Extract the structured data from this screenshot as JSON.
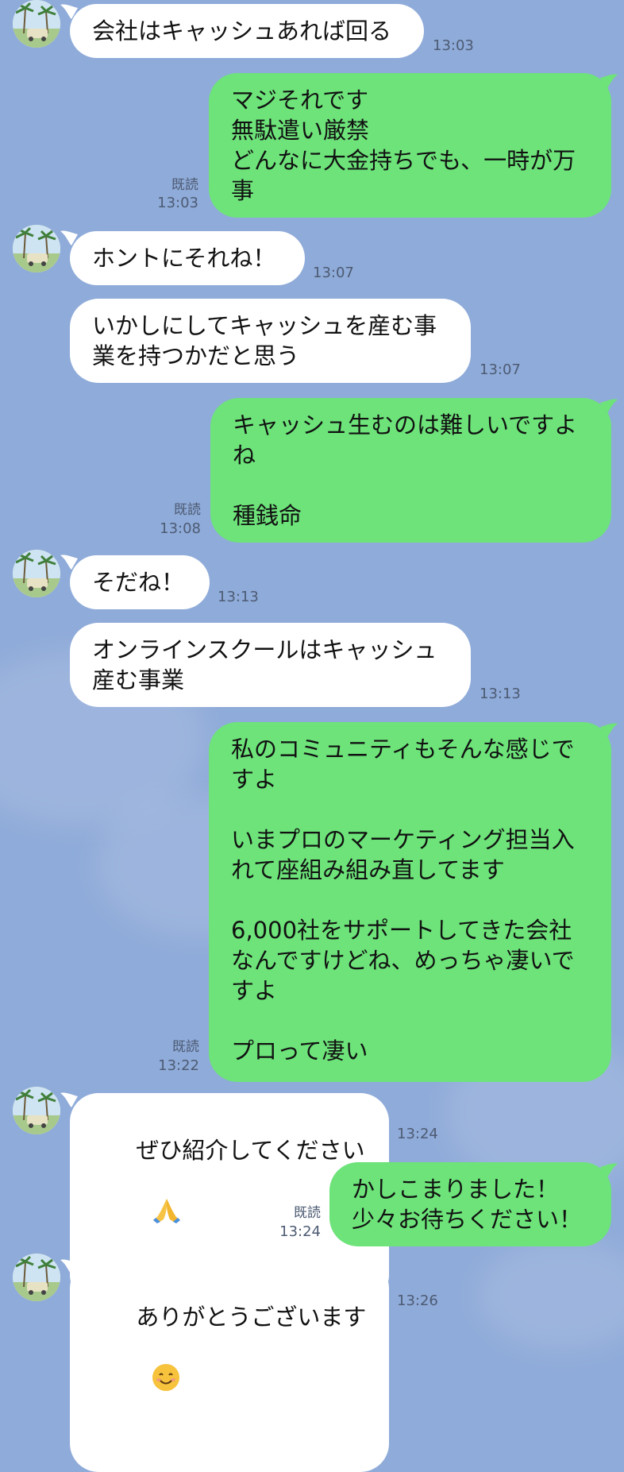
{
  "chat": {
    "read_label": "既読",
    "messages": [
      {
        "side": "in",
        "text": "会社はキャッシュあれば回る",
        "time": "13:03",
        "avatar": true
      },
      {
        "side": "out",
        "text": "マジそれです\n無駄遣い厳禁\nどんなに大金持ちでも、一時が万事",
        "time": "13:03",
        "read": "既読"
      },
      {
        "side": "in",
        "text": "ホントにそれね！",
        "time": "13:07",
        "avatar": true
      },
      {
        "side": "in",
        "text": "いかしにしてキャッシュを産む事業を持つかだと思う",
        "time": "13:07"
      },
      {
        "side": "out",
        "text": "キャッシュ生むのは難しいですよね\n\n種銭命",
        "time": "13:08",
        "read": "既読"
      },
      {
        "side": "in",
        "text": "そだね！",
        "time": "13:13",
        "avatar": true
      },
      {
        "side": "in",
        "text": "オンラインスクールはキャッシュ産む事業",
        "time": "13:13"
      },
      {
        "side": "out",
        "text": "私のコミュニティもそんな感じですよ\n\nいまプロのマーケティング担当入れて座組み組み直してます\n\n6,000社をサポートしてきた会社なんですけどね、めっちゃ凄いですよ\n\nプロって凄い",
        "time": "13:22",
        "read": "既読"
      },
      {
        "side": "in",
        "text": "ぜひ紹介してください",
        "emoji": "pray-emoji",
        "time": "13:24",
        "avatar": true
      },
      {
        "side": "out",
        "text": "かしこまりました！\n少々お待ちください！",
        "time": "13:24",
        "read": "既読"
      },
      {
        "side": "in",
        "text": "ありがとうございます",
        "emoji": "smile-emoji",
        "time": "13:26",
        "avatar": true
      }
    ]
  },
  "colors": {
    "background": "#8fabd9",
    "incoming_bubble": "#ffffff",
    "outgoing_bubble": "#6de37a",
    "meta_text": "#4d5b73"
  }
}
